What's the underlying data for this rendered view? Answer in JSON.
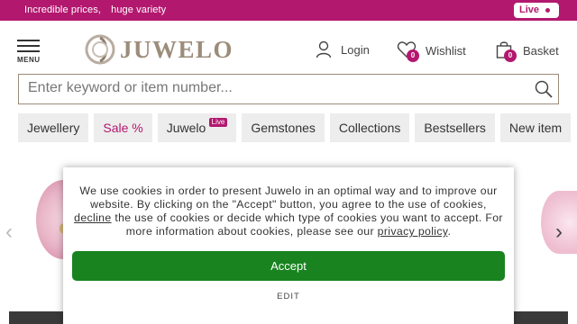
{
  "topbar": {
    "promo_1": "Incredible prices,",
    "promo_2": "huge variety",
    "live_label": "Live",
    "colors": {
      "background": "#b3186f",
      "text": "#ffffff"
    }
  },
  "header": {
    "menu_label": "MENU",
    "logo_text": "JUWELO",
    "login_label": "Login",
    "wishlist_label": "Wishlist",
    "wishlist_count": "0",
    "basket_label": "Basket",
    "basket_count": "0",
    "icons": [
      "hamburger-icon",
      "juwelo-logo-mark",
      "user-icon",
      "heart-icon",
      "shopping-bag-icon"
    ]
  },
  "search": {
    "placeholder": "Enter keyword or item number...",
    "value": "",
    "icon": "search-icon"
  },
  "nav": {
    "items": [
      {
        "label": "Jewellery"
      },
      {
        "label": "Sale %"
      },
      {
        "label": "Juwelo",
        "tag": "Live"
      },
      {
        "label": "Gemstones"
      },
      {
        "label": "Collections"
      },
      {
        "label": "Bestsellers"
      },
      {
        "label": "New item"
      }
    ]
  },
  "hero": {
    "prev_icon": "chevron-left-icon",
    "next_icon": "chevron-right-icon"
  },
  "cookie_banner": {
    "text_1": "We use cookies in order to present Juwelo in an optimal way and to improve our website. By clicking on the \"Accept\" button, you agree to the use of cookies, ",
    "decline_link": "decline",
    "text_2": " the use of cookies or decide which type of cookies you want to accept. For more information about cookies, please see our ",
    "privacy_link": "privacy policy",
    "text_3": ".",
    "accept_label": "Accept",
    "edit_label": "EDIT",
    "colors": {
      "accept": "#18831f"
    }
  },
  "colors": {
    "brand": "#b3186f",
    "logo": "#9c8c7a"
  }
}
